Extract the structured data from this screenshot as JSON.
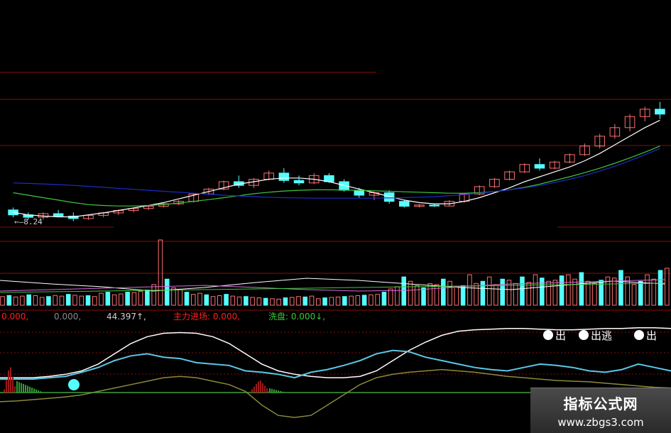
{
  "watermark": {
    "title": "指标公式网",
    "url": "www.zbgs3.com"
  },
  "colors": {
    "up": "#ff7070",
    "down": "#54ffff",
    "ma_short": "#ffffff",
    "ma_mid": "#3cc83c",
    "ma_long": "#1e2cc8",
    "grid": "#8a0c0c",
    "rise_bar": "#9e1818",
    "wash_bar": "#2ea02e",
    "flow_line": "#5ac8e6",
    "low_line": "#8a8a3c",
    "zero_line": "#3ca03c"
  },
  "chart_data": [
    {
      "type": "candlestick",
      "low_label": "8.24",
      "low_marker": "←",
      "candles": [
        {
          "o": 8.7,
          "h": 8.8,
          "l": 8.4,
          "c": 8.5
        },
        {
          "o": 8.5,
          "h": 8.6,
          "l": 8.3,
          "c": 8.4
        },
        {
          "o": 8.4,
          "h": 8.6,
          "l": 8.3,
          "c": 8.55
        },
        {
          "o": 8.55,
          "h": 8.7,
          "l": 8.4,
          "c": 8.45
        },
        {
          "o": 8.45,
          "h": 8.6,
          "l": 8.24,
          "c": 8.35
        },
        {
          "o": 8.35,
          "h": 8.5,
          "l": 8.3,
          "c": 8.48
        },
        {
          "o": 8.48,
          "h": 8.62,
          "l": 8.4,
          "c": 8.58
        },
        {
          "o": 8.58,
          "h": 8.72,
          "l": 8.5,
          "c": 8.68
        },
        {
          "o": 8.68,
          "h": 8.8,
          "l": 8.6,
          "c": 8.76
        },
        {
          "o": 8.76,
          "h": 8.9,
          "l": 8.7,
          "c": 8.85
        },
        {
          "o": 8.85,
          "h": 9.0,
          "l": 8.8,
          "c": 8.95
        },
        {
          "o": 8.95,
          "h": 9.1,
          "l": 8.9,
          "c": 9.05
        },
        {
          "o": 9.05,
          "h": 9.4,
          "l": 9.0,
          "c": 9.35
        },
        {
          "o": 9.35,
          "h": 9.6,
          "l": 9.3,
          "c": 9.55
        },
        {
          "o": 9.55,
          "h": 9.9,
          "l": 9.5,
          "c": 9.85
        },
        {
          "o": 9.85,
          "h": 10.1,
          "l": 9.6,
          "c": 9.7
        },
        {
          "o": 9.7,
          "h": 10.0,
          "l": 9.6,
          "c": 9.95
        },
        {
          "o": 9.95,
          "h": 10.3,
          "l": 9.9,
          "c": 10.2
        },
        {
          "o": 10.2,
          "h": 10.4,
          "l": 9.8,
          "c": 9.9
        },
        {
          "o": 9.9,
          "h": 10.1,
          "l": 9.7,
          "c": 9.8
        },
        {
          "o": 9.8,
          "h": 10.2,
          "l": 9.75,
          "c": 10.1
        },
        {
          "o": 10.1,
          "h": 10.2,
          "l": 9.8,
          "c": 9.85
        },
        {
          "o": 9.85,
          "h": 9.95,
          "l": 9.45,
          "c": 9.5
        },
        {
          "o": 9.5,
          "h": 9.6,
          "l": 9.2,
          "c": 9.3
        },
        {
          "o": 9.3,
          "h": 9.45,
          "l": 9.1,
          "c": 9.4
        },
        {
          "o": 9.4,
          "h": 9.5,
          "l": 8.95,
          "c": 9.05
        },
        {
          "o": 9.05,
          "h": 9.1,
          "l": 8.8,
          "c": 8.85
        },
        {
          "o": 8.85,
          "h": 8.95,
          "l": 8.8,
          "c": 8.9
        },
        {
          "o": 8.9,
          "h": 8.95,
          "l": 8.82,
          "c": 8.86
        },
        {
          "o": 8.86,
          "h": 9.1,
          "l": 8.84,
          "c": 9.05
        },
        {
          "o": 9.05,
          "h": 9.4,
          "l": 9.0,
          "c": 9.35
        },
        {
          "o": 9.35,
          "h": 9.7,
          "l": 9.3,
          "c": 9.65
        },
        {
          "o": 9.65,
          "h": 10.0,
          "l": 9.6,
          "c": 9.95
        },
        {
          "o": 9.95,
          "h": 10.3,
          "l": 9.9,
          "c": 10.25
        },
        {
          "o": 10.25,
          "h": 10.6,
          "l": 10.2,
          "c": 10.55
        },
        {
          "o": 10.55,
          "h": 10.8,
          "l": 10.3,
          "c": 10.4
        },
        {
          "o": 10.4,
          "h": 10.7,
          "l": 10.35,
          "c": 10.65
        },
        {
          "o": 10.65,
          "h": 11.0,
          "l": 10.6,
          "c": 10.95
        },
        {
          "o": 10.95,
          "h": 11.4,
          "l": 10.9,
          "c": 11.3
        },
        {
          "o": 11.3,
          "h": 11.8,
          "l": 11.2,
          "c": 11.7
        },
        {
          "o": 11.7,
          "h": 12.2,
          "l": 11.6,
          "c": 12.05
        },
        {
          "o": 12.05,
          "h": 12.6,
          "l": 11.9,
          "c": 12.5
        },
        {
          "o": 12.5,
          "h": 12.9,
          "l": 12.3,
          "c": 12.8
        },
        {
          "o": 12.8,
          "h": 13.1,
          "l": 12.4,
          "c": 12.6
        }
      ],
      "ma": [
        {
          "name": "ma_short",
          "color": "#ffffff",
          "values": [
            8.6,
            8.5,
            8.45,
            8.42,
            8.42,
            8.5,
            8.58,
            8.68,
            8.78,
            8.88,
            9.0,
            9.15,
            9.3,
            9.45,
            9.6,
            9.75,
            9.85,
            9.95,
            10.0,
            10.0,
            9.95,
            9.85,
            9.7,
            9.55,
            9.4,
            9.25,
            9.1,
            9.0,
            8.95,
            8.95,
            9.05,
            9.2,
            9.4,
            9.6,
            9.85,
            10.05,
            10.25,
            10.45,
            10.7,
            11.0,
            11.35,
            11.7,
            12.05,
            12.35
          ]
        },
        {
          "name": "ma_mid",
          "color": "#3cc83c",
          "values": [
            9.4,
            9.3,
            9.2,
            9.1,
            9.0,
            8.92,
            8.88,
            8.86,
            8.86,
            8.88,
            8.92,
            8.98,
            9.05,
            9.12,
            9.2,
            9.28,
            9.36,
            9.42,
            9.47,
            9.5,
            9.52,
            9.52,
            9.51,
            9.5,
            9.48,
            9.46,
            9.44,
            9.42,
            9.4,
            9.38,
            9.38,
            9.4,
            9.45,
            9.52,
            9.62,
            9.75,
            9.9,
            10.05,
            10.22,
            10.4,
            10.6,
            10.82,
            11.05,
            11.3
          ]
        },
        {
          "name": "ma_long",
          "color": "#1e2cc8",
          "values": [
            9.8,
            9.78,
            9.76,
            9.73,
            9.7,
            9.66,
            9.62,
            9.58,
            9.54,
            9.5,
            9.46,
            9.42,
            9.38,
            9.34,
            9.3,
            9.27,
            9.24,
            9.22,
            9.2,
            9.19,
            9.18,
            9.18,
            9.18,
            9.18,
            9.18,
            9.19,
            9.2,
            9.22,
            9.24,
            9.28,
            9.32,
            9.38,
            9.45,
            9.52,
            9.6,
            9.7,
            9.82,
            9.95,
            10.1,
            10.28,
            10.48,
            10.7,
            10.95,
            11.2
          ]
        }
      ]
    },
    {
      "type": "bar",
      "values": [
        40,
        45,
        38,
        42,
        48,
        44,
        36,
        40,
        45,
        42,
        50,
        46,
        42,
        44,
        40,
        55,
        60,
        48,
        52,
        60,
        58,
        64,
        70,
        95,
        300,
        120,
        80,
        70,
        60,
        50,
        55,
        48,
        40,
        44,
        50,
        42,
        38,
        40,
        36,
        34,
        32,
        30,
        28,
        34,
        36,
        40,
        38,
        42,
        30,
        34,
        36,
        38,
        40,
        42,
        44,
        46,
        48,
        50,
        60,
        75,
        85,
        130,
        110,
        90,
        80,
        100,
        95,
        120,
        110,
        85,
        90,
        140,
        100,
        110,
        130,
        95,
        120,
        115,
        100,
        130,
        105,
        140,
        125,
        110,
        115,
        135,
        140,
        120,
        150,
        110,
        100,
        115,
        130,
        125,
        160,
        130,
        95,
        110,
        140,
        120,
        160,
        170
      ]
    },
    {
      "type": "line",
      "legend": [
        {
          "text": "0.000,",
          "color": "#ff2020"
        },
        {
          "text": "0.000,",
          "color": "#8a8a8a"
        },
        {
          "text": "44.397↑,",
          "color": "#d0d0d0"
        },
        {
          "text": "主力进场: 0.000,",
          "color": "#ff2020"
        },
        {
          "text": "洗盘: 0.000↓,",
          "color": "#3cc83c"
        }
      ],
      "signal": {
        "char": "出",
        "escape": "逃",
        "count_visible": 3
      },
      "series": [
        {
          "name": "white",
          "values": [
            20,
            20,
            20,
            22,
            25,
            30,
            40,
            55,
            70,
            80,
            85,
            86,
            85,
            80,
            70,
            55,
            40,
            30,
            25,
            22,
            20,
            20,
            22,
            30,
            45,
            60,
            72,
            82,
            88,
            90,
            91,
            92,
            92,
            91,
            90,
            90,
            91,
            92,
            92,
            93,
            93,
            92
          ]
        },
        {
          "name": "cyan",
          "values": [
            18,
            18,
            18,
            20,
            22,
            28,
            35,
            45,
            52,
            55,
            50,
            48,
            42,
            40,
            38,
            30,
            28,
            25,
            20,
            28,
            32,
            38,
            45,
            55,
            60,
            58,
            50,
            45,
            40,
            35,
            32,
            30,
            35,
            40,
            38,
            35,
            30,
            28,
            32,
            40,
            35,
            30
          ]
        },
        {
          "name": "olive",
          "values": [
            -15,
            -14,
            -12,
            -10,
            -8,
            -5,
            0,
            5,
            10,
            15,
            20,
            22,
            20,
            15,
            10,
            0,
            -20,
            -35,
            -38,
            -35,
            -20,
            -5,
            10,
            20,
            25,
            28,
            30,
            32,
            30,
            28,
            25,
            22,
            20,
            18,
            16,
            15,
            14,
            12,
            10,
            8,
            6,
            5
          ]
        }
      ]
    }
  ]
}
